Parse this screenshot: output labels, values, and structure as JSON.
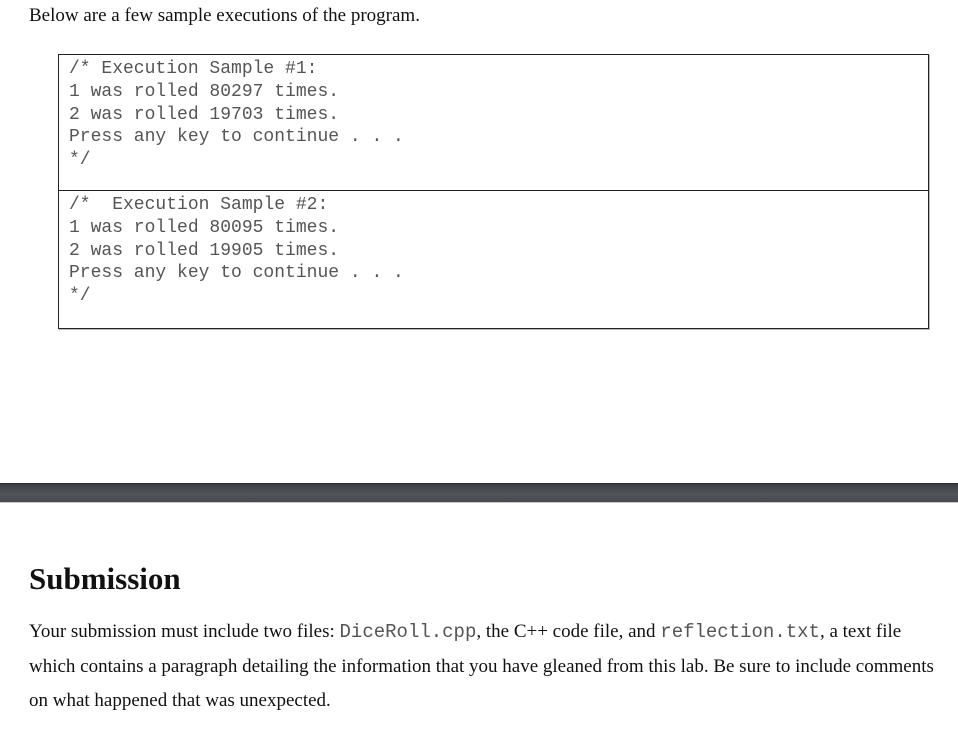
{
  "intro": "Below are a few sample executions of the program.",
  "samples": [
    {
      "lines": "/* Execution Sample #1:\n1 was rolled 80297 times.\n2 was rolled 19703 times.\nPress any key to continue . . .\n*/"
    },
    {
      "lines": "/*  Execution Sample #2:\n1 was rolled 80095 times.\n2 was rolled 19905 times.\nPress any key to continue . . .\n*/"
    }
  ],
  "submission": {
    "heading": "Submission",
    "text_1": "Your submission must include two files: ",
    "file_1": "DiceRoll.cpp",
    "text_2": ", the C++ code file, and ",
    "file_2": "reflection.txt",
    "text_3": ", a text file which contains a paragraph detailing the information that you have gleaned from this lab. Be sure to include comments on what happened that was unexpected."
  }
}
